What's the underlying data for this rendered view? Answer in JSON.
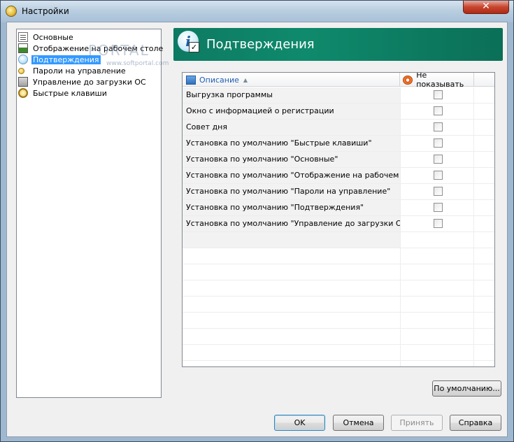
{
  "window": {
    "title": "Настройки",
    "close_glyph": "✕"
  },
  "watermark": {
    "brand": "PORTAL",
    "url": "www.softportal.com"
  },
  "sidebar": {
    "items": [
      {
        "label": "Основные",
        "icon": "document-icon"
      },
      {
        "label": "Отображение на рабочем столе",
        "icon": "desktop-icon"
      },
      {
        "label": "Подтверждения",
        "icon": "info-icon",
        "selected": true
      },
      {
        "label": "Пароли на управление",
        "icon": "key-icon"
      },
      {
        "label": "Управление до загрузки ОС",
        "icon": "boot-icon"
      },
      {
        "label": "Быстрые клавиши",
        "icon": "magnifier-icon"
      }
    ]
  },
  "header": {
    "title": "Подтверждения",
    "icon_glyph": "i",
    "check_glyph": "✓"
  },
  "table": {
    "columns": {
      "description": "Описание",
      "hide": "Не показывать"
    },
    "sort_glyph": "▲",
    "rows": [
      {
        "description": "Выгрузка программы",
        "checked": false
      },
      {
        "description": "Окно с информацией о регистрации",
        "checked": false
      },
      {
        "description": "Совет дня",
        "checked": false
      },
      {
        "description": "Установка по умолчанию \"Быстрые клавиши\"",
        "checked": false
      },
      {
        "description": "Установка по умолчанию \"Основные\"",
        "checked": false
      },
      {
        "description": "Установка по умолчанию \"Отображение на рабочем столе\"",
        "checked": false
      },
      {
        "description": "Установка по умолчанию \"Пароли на управление\"",
        "checked": false
      },
      {
        "description": "Установка по умолчанию \"Подтверждения\"",
        "checked": false
      },
      {
        "description": "Установка по умолчанию \"Управление до загрузки ОС\"",
        "checked": false
      }
    ]
  },
  "buttons": {
    "defaults": "По умолчанию...",
    "ok": "OK",
    "cancel": "Отмена",
    "apply": "Принять",
    "help": "Справка"
  },
  "colors": {
    "header_band": "#0f8a6c",
    "selection": "#3399ff",
    "column_link": "#1f5fb4"
  }
}
